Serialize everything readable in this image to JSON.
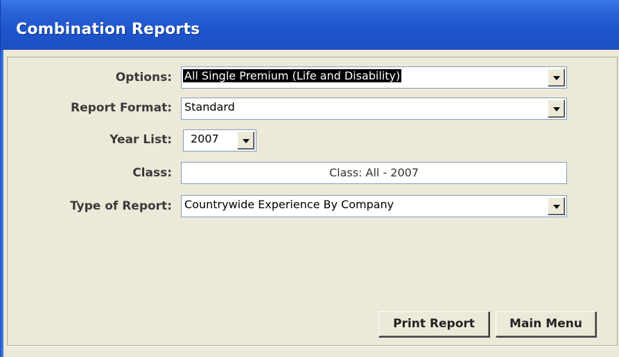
{
  "window": {
    "title": "Combination Reports"
  },
  "form": {
    "options": {
      "label": "Options:",
      "value": "All Single Premium (Life and Disability)"
    },
    "report_format": {
      "label": "Report Format:",
      "value": "Standard"
    },
    "year_list": {
      "label": "Year List:",
      "value": "2007"
    },
    "class": {
      "label": "Class:",
      "value": "Class: All - 2007"
    },
    "type_of_report": {
      "label": "Type of Report:",
      "value": "Countrywide Experience By Company"
    }
  },
  "buttons": {
    "print_report": "Print Report",
    "main_menu": "Main Menu"
  },
  "icons": {
    "dropdown": "chevron-down-icon"
  }
}
